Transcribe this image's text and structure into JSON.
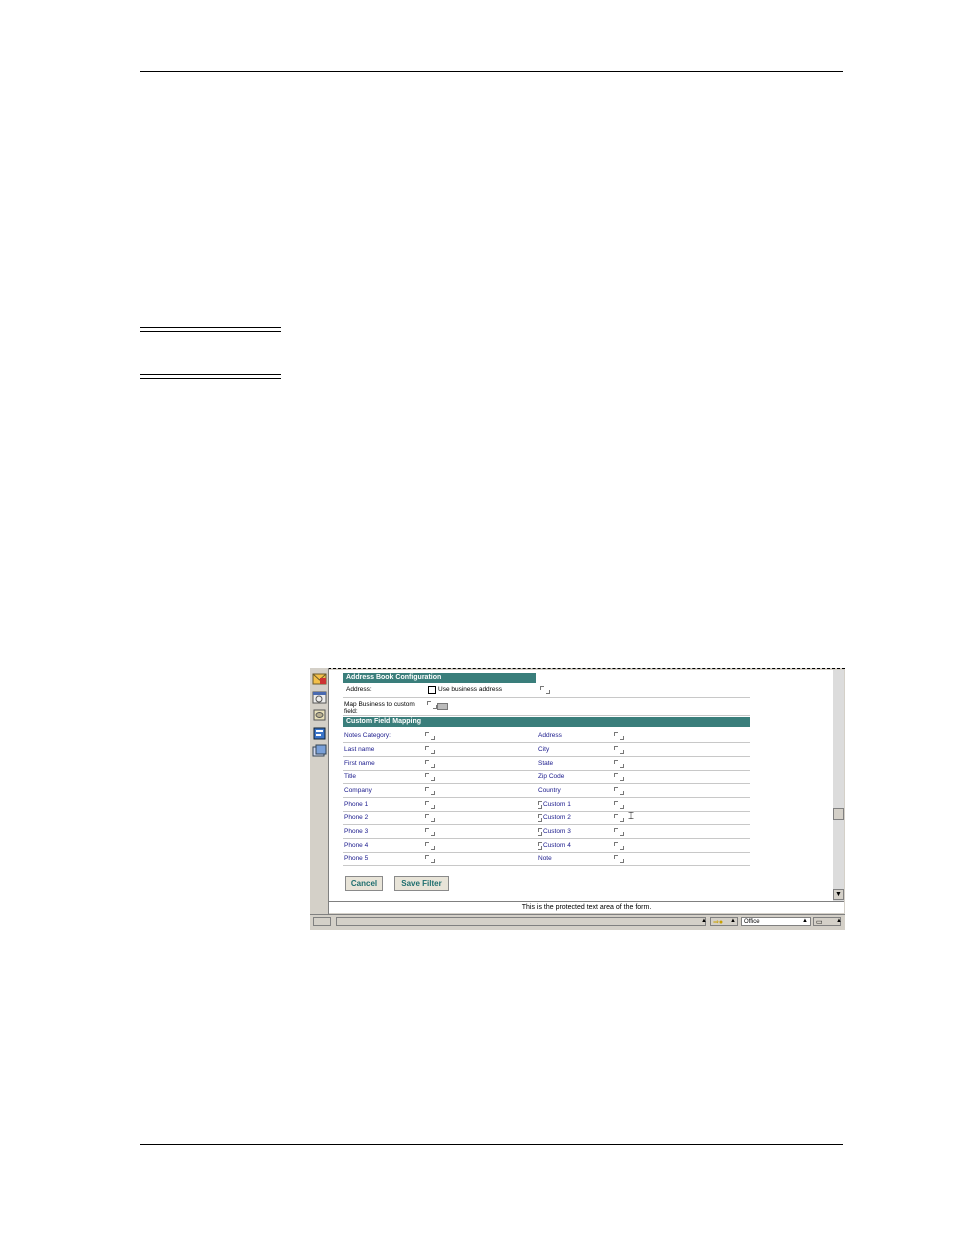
{
  "form": {
    "section_address_book": "Address Book Configuration",
    "address_label": "Address:",
    "use_business_label": "Use business address",
    "map_business_label_1": "Map Business to custom",
    "map_business_label_2": "field:",
    "section_custom_mapping": "Custom Field Mapping",
    "rows": [
      {
        "left": "Notes Category:",
        "right": "Address"
      },
      {
        "left": "Last name",
        "right": "City"
      },
      {
        "left": "First name",
        "right": "State"
      },
      {
        "left": "Title",
        "right": "Zip Code"
      },
      {
        "left": "Company",
        "right": "Country"
      },
      {
        "left": "Phone 1",
        "right": "Custom 1"
      },
      {
        "left": "Phone 2",
        "right": "Custom 2"
      },
      {
        "left": "Phone 3",
        "right": "Custom 3"
      },
      {
        "left": "Phone 4",
        "right": "Custom 4"
      },
      {
        "left": "Phone 5",
        "right": "Note"
      }
    ],
    "cancel_label": "Cancel",
    "save_filter_label": "Save Filter",
    "protected_text": "This is the protected text area of the form."
  },
  "statusbar": {
    "location_value": "Office"
  },
  "icons": [
    "mail-icon",
    "calendar-icon",
    "database-icon",
    "address-book-icon",
    "replica-icon"
  ],
  "colors": {
    "section_header": "#3a7e7b",
    "label_text": "#1a1a8c",
    "button_text": "#1f6f6f"
  }
}
